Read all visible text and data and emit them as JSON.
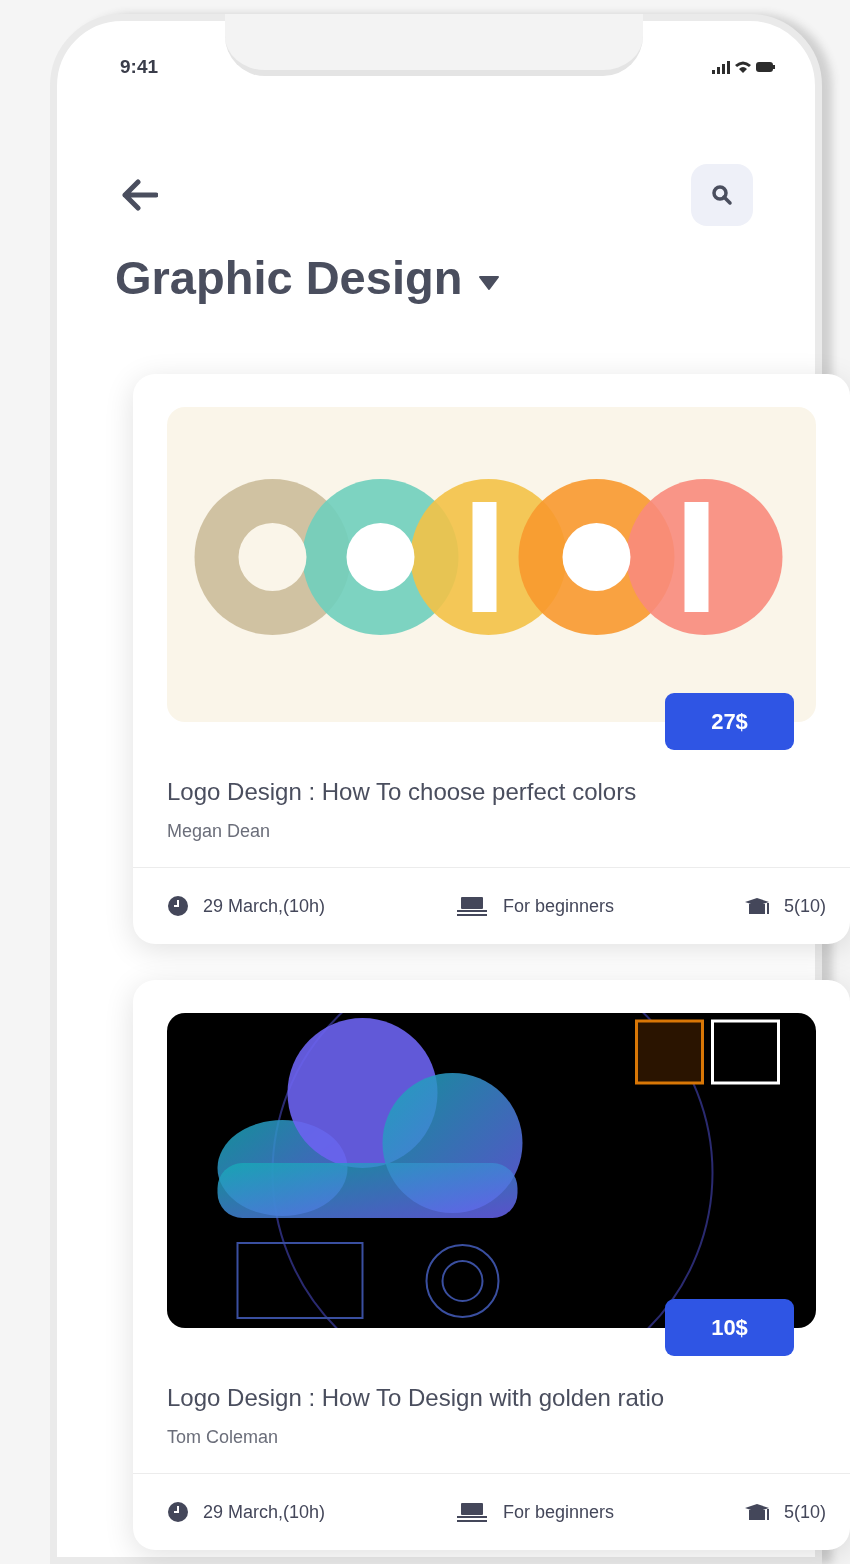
{
  "status_bar": {
    "time": "9:41"
  },
  "header": {
    "title": "Graphic Design"
  },
  "courses": [
    {
      "price": "27$",
      "title": "Logo Design : How To choose perfect colors",
      "author": "Megan Dean",
      "date": "29 March,(10h)",
      "audience": "For beginners",
      "score": "5(10)"
    },
    {
      "price": "10$",
      "title": "Logo Design : How To Design with golden ratio",
      "author": "Tom Coleman",
      "date": "29 March,(10h)",
      "audience": "For beginners",
      "score": "5(10)"
    }
  ]
}
